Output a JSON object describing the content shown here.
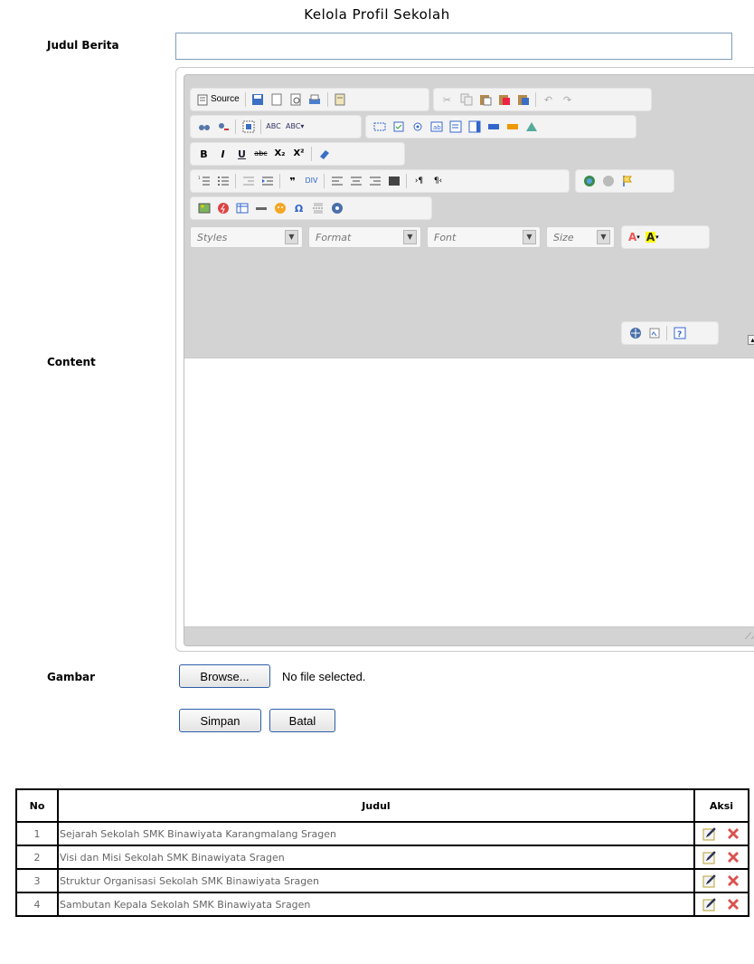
{
  "page_title": "Kelola Profil Sekolah",
  "form": {
    "judul_label": "Judul Berita",
    "judul_value": "",
    "content_label": "Content",
    "gambar_label": "Gambar",
    "browse_label": "Browse...",
    "file_status": "No file selected.",
    "save_label": "Simpan",
    "cancel_label": "Batal"
  },
  "editor": {
    "source_label": "Source",
    "styles_placeholder": "Styles",
    "format_placeholder": "Format",
    "font_placeholder": "Font",
    "size_placeholder": "Size",
    "bold": "B",
    "italic": "I",
    "underline": "U"
  },
  "table": {
    "headers": [
      "No",
      "Judul",
      "Aksi"
    ],
    "rows": [
      {
        "no": "1",
        "judul": "Sejarah Sekolah SMK Binawiyata Karangmalang Sragen"
      },
      {
        "no": "2",
        "judul": "Visi dan Misi Sekolah SMK Binawiyata Sragen"
      },
      {
        "no": "3",
        "judul": "Struktur Organisasi Sekolah SMK Binawiyata Sragen"
      },
      {
        "no": "4",
        "judul": "Sambutan Kepala Sekolah SMK Binawiyata Sragen"
      }
    ]
  },
  "colors": {
    "input_border": "#7f9db9",
    "button_border": "#2d5ea8",
    "edit_icon": "#e9c531",
    "delete_icon": "#d9534f"
  },
  "icons": [
    "edit-icon",
    "delete-icon"
  ]
}
